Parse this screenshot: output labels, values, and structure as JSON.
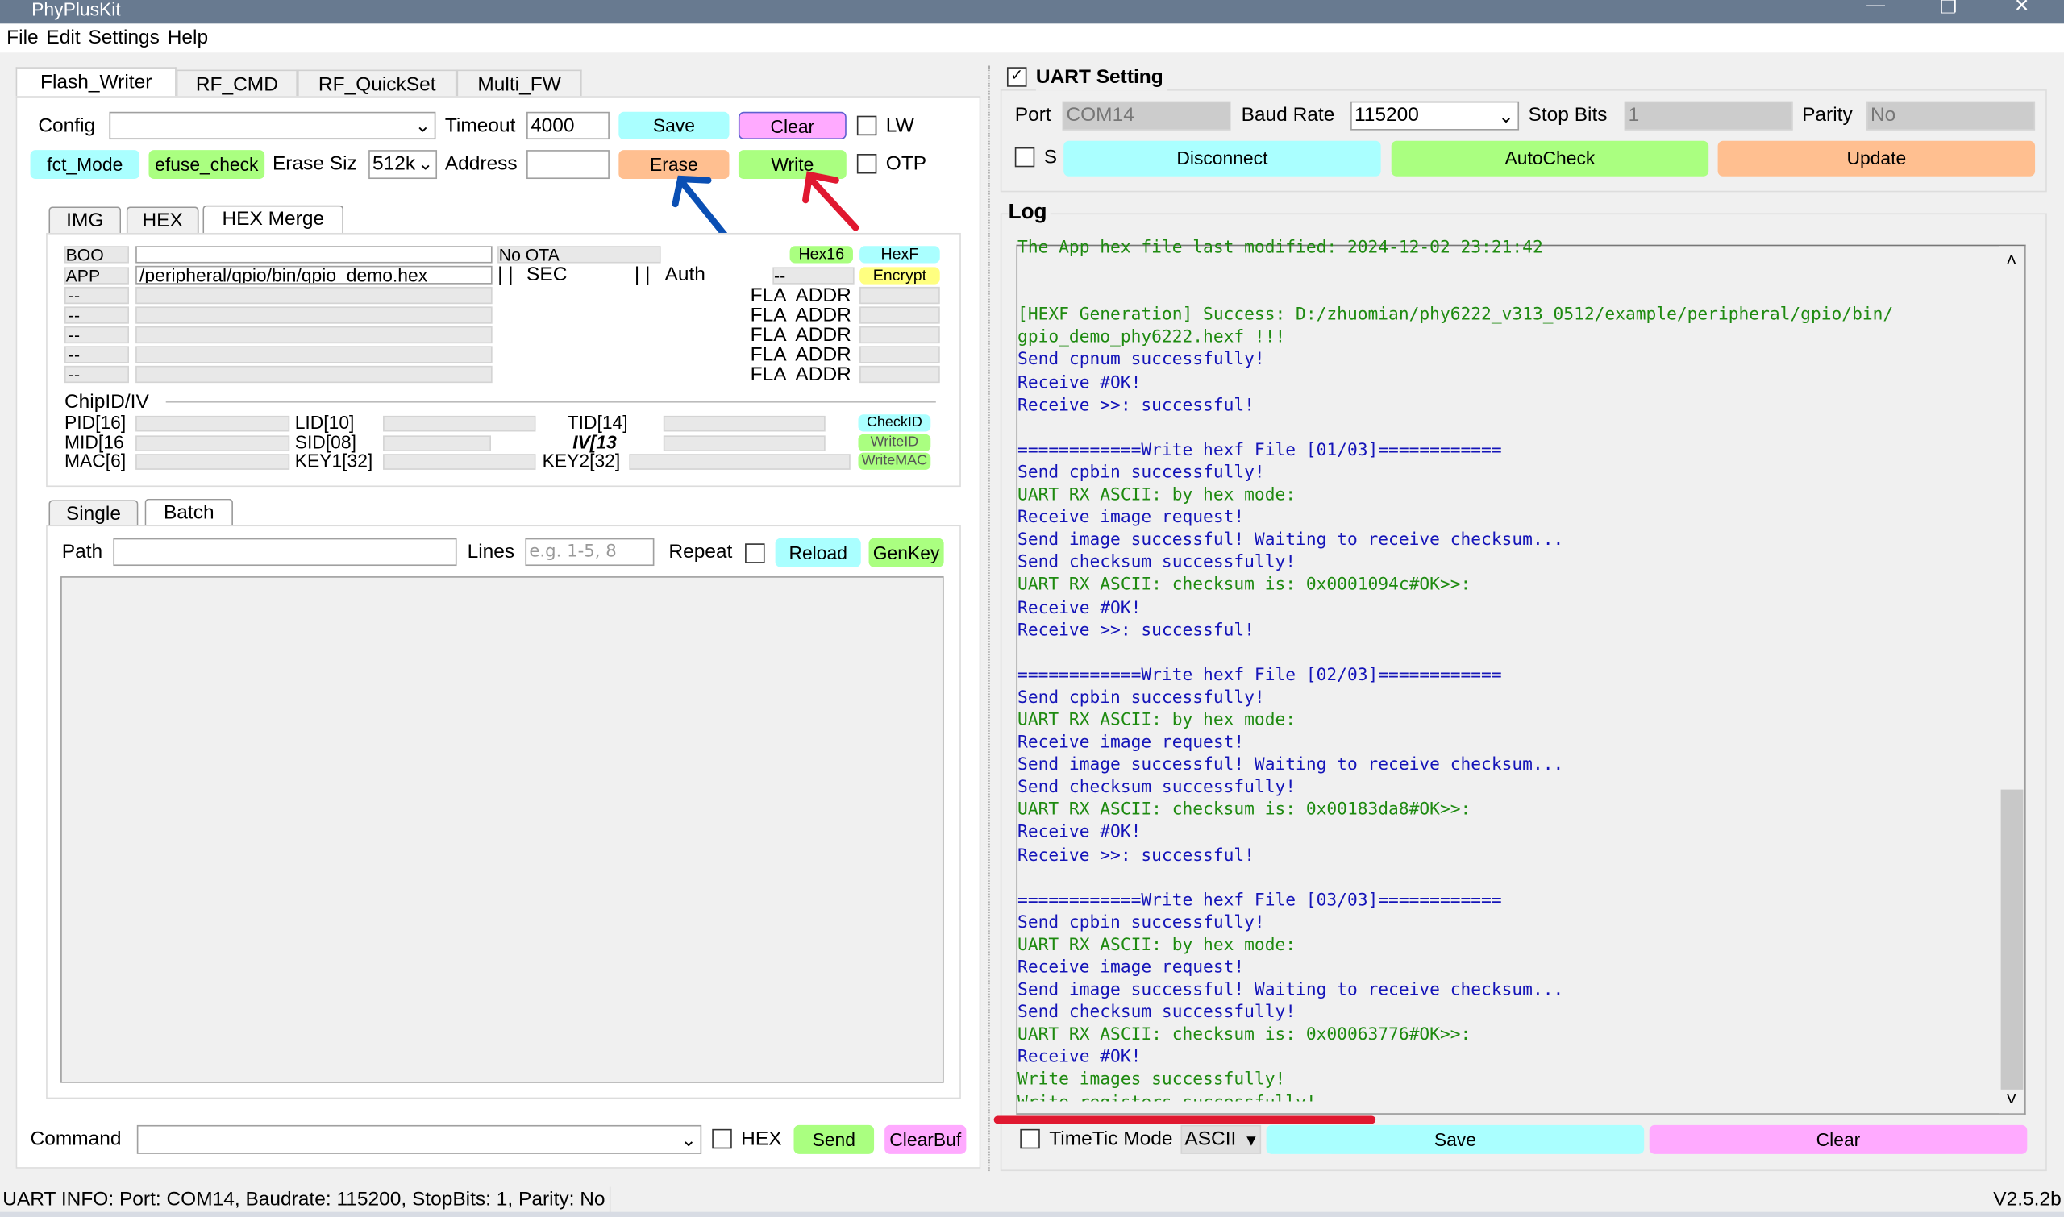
{
  "window": {
    "title": "PhyPlusKit"
  },
  "menu": [
    "File",
    "Edit",
    "Settings",
    "Help"
  ],
  "main_tabs": [
    "Flash_Writer",
    "RF_CMD",
    "RF_QuickSet",
    "Multi_FW"
  ],
  "flash": {
    "config_label": "Config",
    "config_value": "",
    "timeout_label": "Timeout",
    "timeout_value": "4000",
    "save": "Save",
    "clear": "Clear",
    "lw": "LW",
    "fct_mode": "fct_Mode",
    "efuse_check": "efuse_check",
    "erase_size_label": "Erase Siz",
    "erase_size_value": "512k",
    "address_label": "Address",
    "address_value": "",
    "erase": "Erase",
    "write": "Write",
    "otp": "OTP"
  },
  "sub_tabs": [
    "IMG",
    "HEX",
    "HEX Merge"
  ],
  "hexmerge": {
    "row1_sel": "BOO",
    "ota": "No OTA",
    "hex16": "Hex16",
    "hexf": "HexF",
    "row2_sel": "APP",
    "row2_path": "/peripheral/gpio/bin/gpio_demo.hex",
    "sec": "SEC",
    "auth": "Auth",
    "enc_sel": "--",
    "encrypt": "Encrypt",
    "empty_sel": "--",
    "fla_addr": "FLA  ADDR"
  },
  "chipid": {
    "title": "ChipID/IV",
    "pid": "PID[16]",
    "lid": "LID[10]",
    "tid": "TID[14]",
    "mid": "MID[16",
    "sid": "SID[08]",
    "iv": "IV[13",
    "mac": "MAC[6]",
    "key1": "KEY1[32]",
    "key2": "KEY2[32]",
    "checkid": "CheckID",
    "writeid": "WriteID",
    "writemac": "WriteMAC"
  },
  "batch_tabs": [
    "Single",
    "Batch"
  ],
  "batch": {
    "path_label": "Path",
    "path_value": "",
    "lines_label": "Lines",
    "lines_placeholder": "e.g. 1-5, 8",
    "repeat_label": "Repeat",
    "reload": "Reload",
    "genkey": "GenKey"
  },
  "command": {
    "label": "Command",
    "value": "",
    "hex": "HEX",
    "send": "Send",
    "clearbuf": "ClearBuf"
  },
  "uart": {
    "title": "UART Setting",
    "checked": true,
    "port_label": "Port",
    "port": "COM14",
    "baud_label": "Baud Rate",
    "baud": "115200",
    "stop_label": "Stop Bits",
    "stop": "1",
    "parity_label": "Parity",
    "parity": "No",
    "s_label": "S",
    "disconnect": "Disconnect",
    "autocheck": "AutoCheck",
    "update": "Update"
  },
  "log": {
    "title": "Log",
    "lines": [
      {
        "t": "The App hex file last modified: 2024-12-02 23:21:42",
        "c": "g"
      },
      {
        "t": "",
        "c": "g"
      },
      {
        "t": "",
        "c": "g"
      },
      {
        "t": "[HEXF Generation] Success: D:/zhuomian/phy6222_v313_0512/example/peripheral/gpio/bin/",
        "c": "g"
      },
      {
        "t": "gpio_demo_phy6222.hexf !!!",
        "c": "g"
      },
      {
        "t": "Send cpnum successfully!",
        "c": "b"
      },
      {
        "t": "Receive #OK!",
        "c": "b"
      },
      {
        "t": "Receive >>: successful!",
        "c": "b"
      },
      {
        "t": "",
        "c": "b"
      },
      {
        "t": "============Write hexf File [01/03]============",
        "c": "b"
      },
      {
        "t": "Send cpbin successfully!",
        "c": "b"
      },
      {
        "t": "UART RX ASCII: by hex mode:",
        "c": "g"
      },
      {
        "t": "Receive image request!",
        "c": "b"
      },
      {
        "t": "Send image successful! Waiting to receive checksum...",
        "c": "b"
      },
      {
        "t": "Send checksum successfully!",
        "c": "b"
      },
      {
        "t": "UART RX ASCII: checksum is: 0x0001094c#OK>>:",
        "c": "g"
      },
      {
        "t": "Receive #OK!",
        "c": "b"
      },
      {
        "t": "Receive >>: successful!",
        "c": "b"
      },
      {
        "t": "",
        "c": "b"
      },
      {
        "t": "============Write hexf File [02/03]============",
        "c": "b"
      },
      {
        "t": "Send cpbin successfully!",
        "c": "b"
      },
      {
        "t": "UART RX ASCII: by hex mode:",
        "c": "g"
      },
      {
        "t": "Receive image request!",
        "c": "b"
      },
      {
        "t": "Send image successful! Waiting to receive checksum...",
        "c": "b"
      },
      {
        "t": "Send checksum successfully!",
        "c": "b"
      },
      {
        "t": "UART RX ASCII: checksum is: 0x00183da8#OK>>:",
        "c": "g"
      },
      {
        "t": "Receive #OK!",
        "c": "b"
      },
      {
        "t": "Receive >>: successful!",
        "c": "b"
      },
      {
        "t": "",
        "c": "b"
      },
      {
        "t": "============Write hexf File [03/03]============",
        "c": "b"
      },
      {
        "t": "Send cpbin successfully!",
        "c": "b"
      },
      {
        "t": "UART RX ASCII: by hex mode:",
        "c": "g"
      },
      {
        "t": "Receive image request!",
        "c": "b"
      },
      {
        "t": "Send image successful! Waiting to receive checksum...",
        "c": "b"
      },
      {
        "t": "Send checksum successfully!",
        "c": "b"
      },
      {
        "t": "UART RX ASCII: checksum is: 0x00063776#OK>>:",
        "c": "g"
      },
      {
        "t": "Receive #OK!",
        "c": "b"
      },
      {
        "t": "Write images successfully!",
        "c": "g"
      },
      {
        "t": "Write registers successfully!",
        "c": "g"
      }
    ]
  },
  "log_footer": {
    "timetic": "TimeTic Mode",
    "mode": "ASCII",
    "save": "Save",
    "clear": "Clear"
  },
  "status": {
    "info": "UART INFO: Port: COM14, Baudrate: 115200, StopBits: 1, Parity: No",
    "version": "V2.5.2b"
  },
  "colors": {
    "cyan": "#aaffff",
    "green": "#aaff80",
    "pink": "#ffaaff",
    "orange": "#ffbf90",
    "yellow": "#ffff80",
    "log_green": "#1e8a10",
    "log_blue": "#1414b8",
    "annotation_blue": "#0a4fb4",
    "annotation_red": "#e01830"
  }
}
